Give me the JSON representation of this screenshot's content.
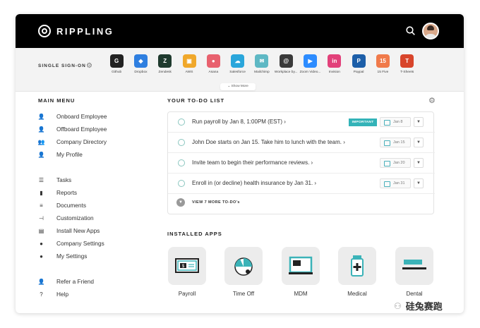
{
  "header": {
    "brand": "RIPPLING"
  },
  "sso": {
    "label": "SINGLE SIGN-ON",
    "show_more": "⌄ Show More",
    "apps": [
      {
        "name": "Github",
        "icon": "github-icon",
        "color": "#222222",
        "glyph": "G"
      },
      {
        "name": "Dropbox",
        "icon": "dropbox-icon",
        "color": "#2f7fe0",
        "glyph": "◆"
      },
      {
        "name": "Zendesk",
        "icon": "zendesk-icon",
        "color": "#1f3a2e",
        "glyph": "Z"
      },
      {
        "name": "AWS",
        "icon": "aws-icon",
        "color": "#f0a82b",
        "glyph": "▣"
      },
      {
        "name": "Asana",
        "icon": "asana-icon",
        "color": "#e8616e",
        "glyph": "●"
      },
      {
        "name": "Salesforce",
        "icon": "salesforce-icon",
        "color": "#2aa6db",
        "glyph": "☁"
      },
      {
        "name": "Mailchimp",
        "icon": "mailchimp-icon",
        "color": "#5eb8c4",
        "glyph": "✉"
      },
      {
        "name": "Workplace by...",
        "icon": "workplace-icon",
        "color": "#3a3a3a",
        "glyph": "@"
      },
      {
        "name": "Zoom Video...",
        "icon": "zoom-icon",
        "color": "#2d8cff",
        "glyph": "▶"
      },
      {
        "name": "Invision",
        "icon": "invision-icon",
        "color": "#e2417a",
        "glyph": "in"
      },
      {
        "name": "Paypal",
        "icon": "paypal-icon",
        "color": "#1c5ea8",
        "glyph": "P"
      },
      {
        "name": "15 Five",
        "icon": "fifteen-five-icon",
        "color": "#f07a4a",
        "glyph": "15"
      },
      {
        "name": "T-Sheets",
        "icon": "tsheets-icon",
        "color": "#d8452b",
        "glyph": "T"
      }
    ]
  },
  "menu": {
    "title": "MAIN MENU",
    "groups": [
      [
        {
          "label": "Onboard Employee",
          "icon": "user-plus-icon",
          "glyph": "👤"
        },
        {
          "label": "Offboard Employee",
          "icon": "user-minus-icon",
          "glyph": "👤"
        },
        {
          "label": "Company Directory",
          "icon": "directory-icon",
          "glyph": "👥"
        },
        {
          "label": "My Profile",
          "icon": "profile-icon",
          "glyph": "👤"
        }
      ],
      [
        {
          "label": "Tasks",
          "icon": "tasks-icon",
          "glyph": "☰"
        },
        {
          "label": "Reports",
          "icon": "reports-icon",
          "glyph": "▮"
        },
        {
          "label": "Documents",
          "icon": "documents-icon",
          "glyph": "≡"
        },
        {
          "label": "Customization",
          "icon": "customization-icon",
          "glyph": "⊣"
        },
        {
          "label": "Install New Apps",
          "icon": "install-apps-icon",
          "glyph": "▤"
        },
        {
          "label": "Company Settings",
          "icon": "company-settings-icon",
          "glyph": "●"
        },
        {
          "label": "My Settings",
          "icon": "my-settings-icon",
          "glyph": "●"
        }
      ],
      [
        {
          "label": "Refer a Friend",
          "icon": "refer-friend-icon",
          "glyph": "👤"
        },
        {
          "label": "Help",
          "icon": "help-icon",
          "glyph": "?"
        }
      ]
    ]
  },
  "todo": {
    "title": "YOUR TO-DO LIST",
    "items": [
      {
        "text": "Run payroll by Jan 8, 1:00PM (EST)  ›",
        "badge": "IMPORTANT",
        "date": "Jan 8"
      },
      {
        "text": "John Doe starts on Jan 15. Take him to lunch with the team.  ›",
        "badge": "",
        "date": "Jan 15"
      },
      {
        "text": "Invite team to begin their performance reviews.  ›",
        "badge": "",
        "date": "Jan 20"
      },
      {
        "text": "Enroll in (or decline) health insurance by Jan 31.  ›",
        "badge": "",
        "date": "Jan 31"
      }
    ],
    "view_more": "VIEW 7 MORE TO-DO's"
  },
  "installed": {
    "title": "INSTALLED APPS",
    "apps": [
      {
        "label": "Payroll",
        "icon": "payroll-icon"
      },
      {
        "label": "Time Off",
        "icon": "time-off-icon"
      },
      {
        "label": "MDM",
        "icon": "mdm-icon"
      },
      {
        "label": "Medical",
        "icon": "medical-icon"
      },
      {
        "label": "Dental",
        "icon": "dental-icon"
      }
    ]
  },
  "watermark": {
    "text": "硅兔赛跑"
  },
  "colors": {
    "accent": "#33b3b8",
    "topbar": "#000000"
  }
}
